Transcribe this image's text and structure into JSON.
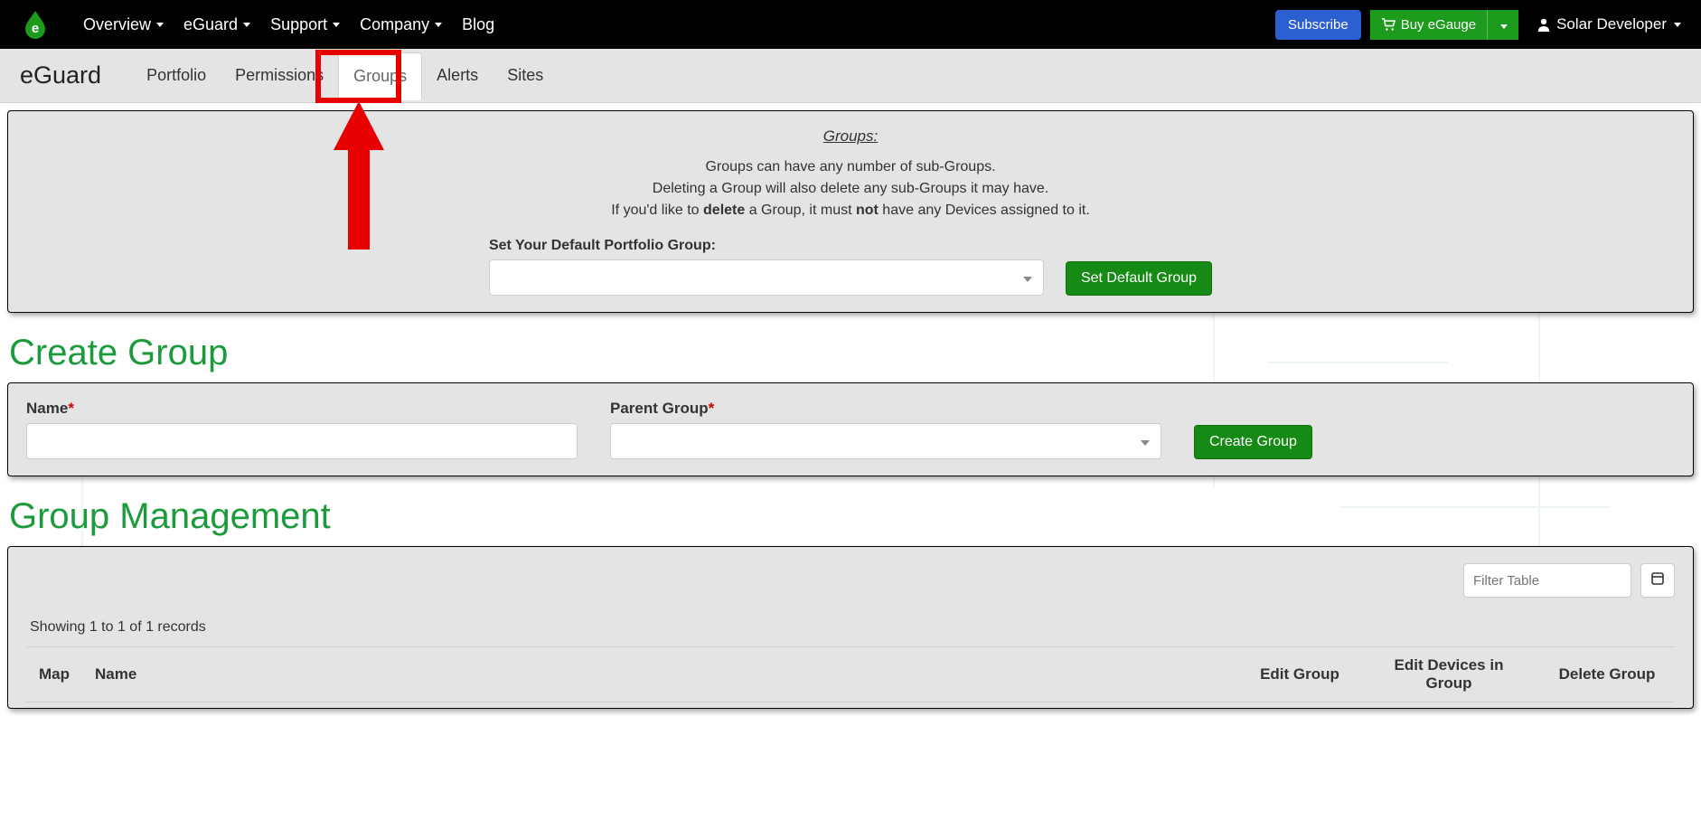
{
  "topnav": {
    "items": [
      {
        "label": "Overview",
        "dropdown": true
      },
      {
        "label": "eGuard",
        "dropdown": true
      },
      {
        "label": "Support",
        "dropdown": true
      },
      {
        "label": "Company",
        "dropdown": true
      },
      {
        "label": "Blog",
        "dropdown": false
      }
    ],
    "subscribe": "Subscribe",
    "buy": "Buy eGauge",
    "user": "Solar Developer"
  },
  "secnav": {
    "brand": "eGuard",
    "tabs": [
      {
        "label": "Portfolio",
        "active": false
      },
      {
        "label": "Permissions",
        "active": false
      },
      {
        "label": "Groups",
        "active": true
      },
      {
        "label": "Alerts",
        "active": false
      },
      {
        "label": "Sites",
        "active": false
      }
    ]
  },
  "help": {
    "title": "Groups:",
    "line1": "Groups can have any number of sub-Groups.",
    "line2": "Deleting a Group will also delete any sub-Groups it may have.",
    "line3_pre": "If you'd like to ",
    "line3_b1": "delete",
    "line3_mid": " a Group, it must ",
    "line3_b2": "not",
    "line3_post": " have any Devices assigned to it.",
    "default_label": "Set Your Default Portfolio Group:",
    "default_button": "Set Default Group"
  },
  "create": {
    "heading": "Create Group",
    "name_label": "Name",
    "parent_label": "Parent Group",
    "button": "Create Group"
  },
  "manage": {
    "heading": "Group Management",
    "filter_placeholder": "Filter Table",
    "records": "Showing 1 to 1 of 1 records",
    "cols": {
      "map": "Map",
      "name": "Name",
      "edit": "Edit Group",
      "devices": "Edit Devices in Group",
      "delete": "Delete Group"
    }
  },
  "colors": {
    "accent_green": "#1c9b3c",
    "btn_green": "#158a15",
    "btn_blue": "#2c5fd1",
    "annotation_red": "#e60000"
  }
}
